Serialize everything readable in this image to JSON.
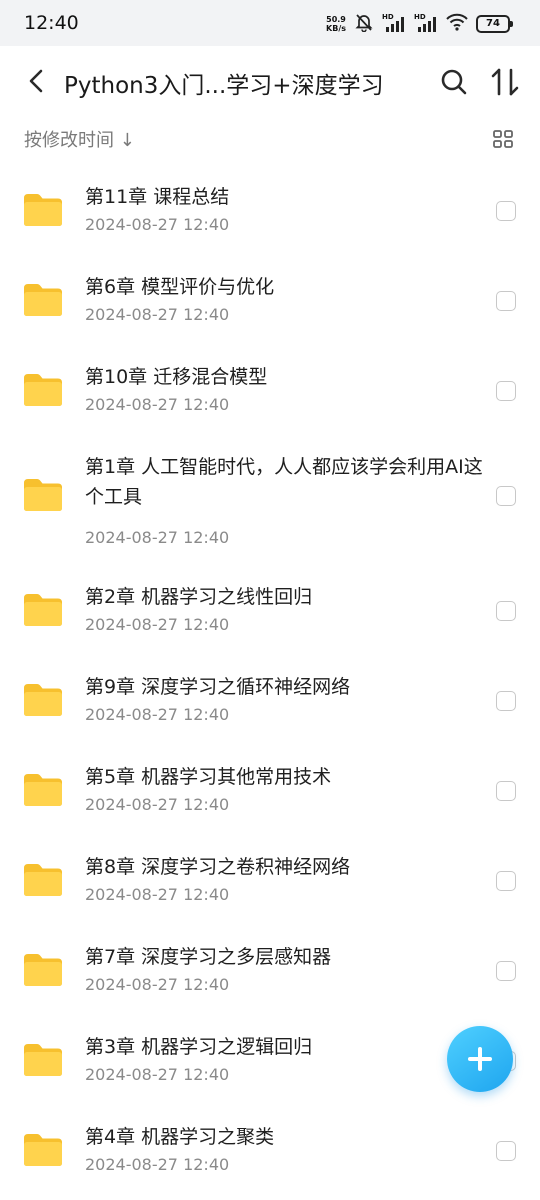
{
  "status_bar": {
    "time": "12:40",
    "net_speed_value": "50.9",
    "net_speed_unit": "KB/s",
    "hd_label": "HD",
    "battery": "74",
    "icons": [
      "mute-bell-icon",
      "signal-hd-icon",
      "signal-hd-icon",
      "wifi-icon",
      "battery-icon"
    ]
  },
  "header": {
    "title": "Python3入门...学习+深度学习",
    "icons": [
      "back-arrow-icon",
      "search-icon",
      "sort-icon"
    ]
  },
  "sort_bar": {
    "label": "按修改时间 ↓",
    "view_icon": "grid-view-icon"
  },
  "files": [
    {
      "name": "第11章 课程总结",
      "date": "2024-08-27 12:40"
    },
    {
      "name": "第6章 模型评价与优化",
      "date": "2024-08-27 12:40"
    },
    {
      "name": "第10章 迁移混合模型",
      "date": "2024-08-27 12:40"
    },
    {
      "name": "第1章 人工智能时代，人人都应该学会利用AI这个工具",
      "date": "2024-08-27 12:40"
    },
    {
      "name": "第2章 机器学习之线性回归",
      "date": "2024-08-27 12:40"
    },
    {
      "name": "第9章 深度学习之循环神经网络",
      "date": "2024-08-27 12:40"
    },
    {
      "name": "第5章 机器学习其他常用技术",
      "date": "2024-08-27 12:40"
    },
    {
      "name": "第8章 深度学习之卷积神经网络",
      "date": "2024-08-27 12:40"
    },
    {
      "name": "第7章 深度学习之多层感知器",
      "date": "2024-08-27 12:40"
    },
    {
      "name": "第3章 机器学习之逻辑回归",
      "date": "2024-08-27 12:40"
    },
    {
      "name": "第4章 机器学习之聚类",
      "date": "2024-08-27 12:40"
    }
  ],
  "fab": {
    "icon": "plus-icon"
  },
  "colors": {
    "accent": "#1ea5ef",
    "folder": "#ffd34d",
    "folder_tab": "#f7c02e",
    "text_secondary": "#8a8a8a"
  }
}
